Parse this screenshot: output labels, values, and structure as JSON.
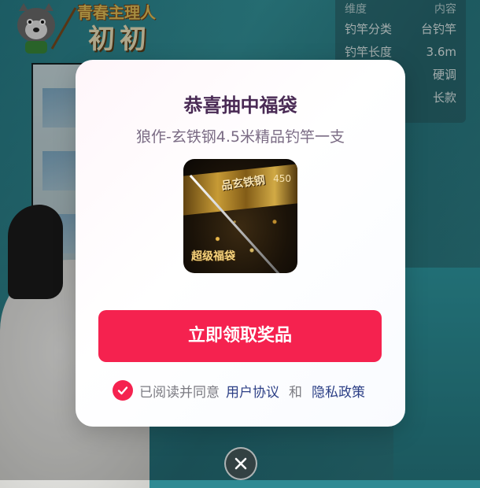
{
  "background": {
    "channel_name": "青春主理人",
    "host_name": "初初",
    "spec_table": {
      "header": {
        "key": "维度",
        "value": "内容"
      },
      "rows": [
        {
          "key": "钓竿分类",
          "value": "台钓竿"
        },
        {
          "key": "钓竿长度",
          "value": "3.6m"
        },
        {
          "key": "",
          "value": "硬调"
        },
        {
          "key": "",
          "value": "长款"
        }
      ]
    }
  },
  "dialog": {
    "title": "恭喜抽中福袋",
    "subtitle": "狼作-玄铁钢4.5米精品钓竿一支",
    "prize_image": {
      "text_top": "品玄铁钢",
      "text_corner": "450",
      "text_bottom": "超级福袋"
    },
    "claim_button": "立即领取奖品",
    "agreement": {
      "prefix": "已阅读并同意",
      "user_agreement": "用户协议",
      "and": "和",
      "privacy_policy": "隐私政策"
    }
  },
  "colors": {
    "accent": "#f5224f",
    "link": "#2c3f86",
    "title": "#4a2b55"
  },
  "icons": {
    "check": "check-icon",
    "close": "close-icon"
  }
}
